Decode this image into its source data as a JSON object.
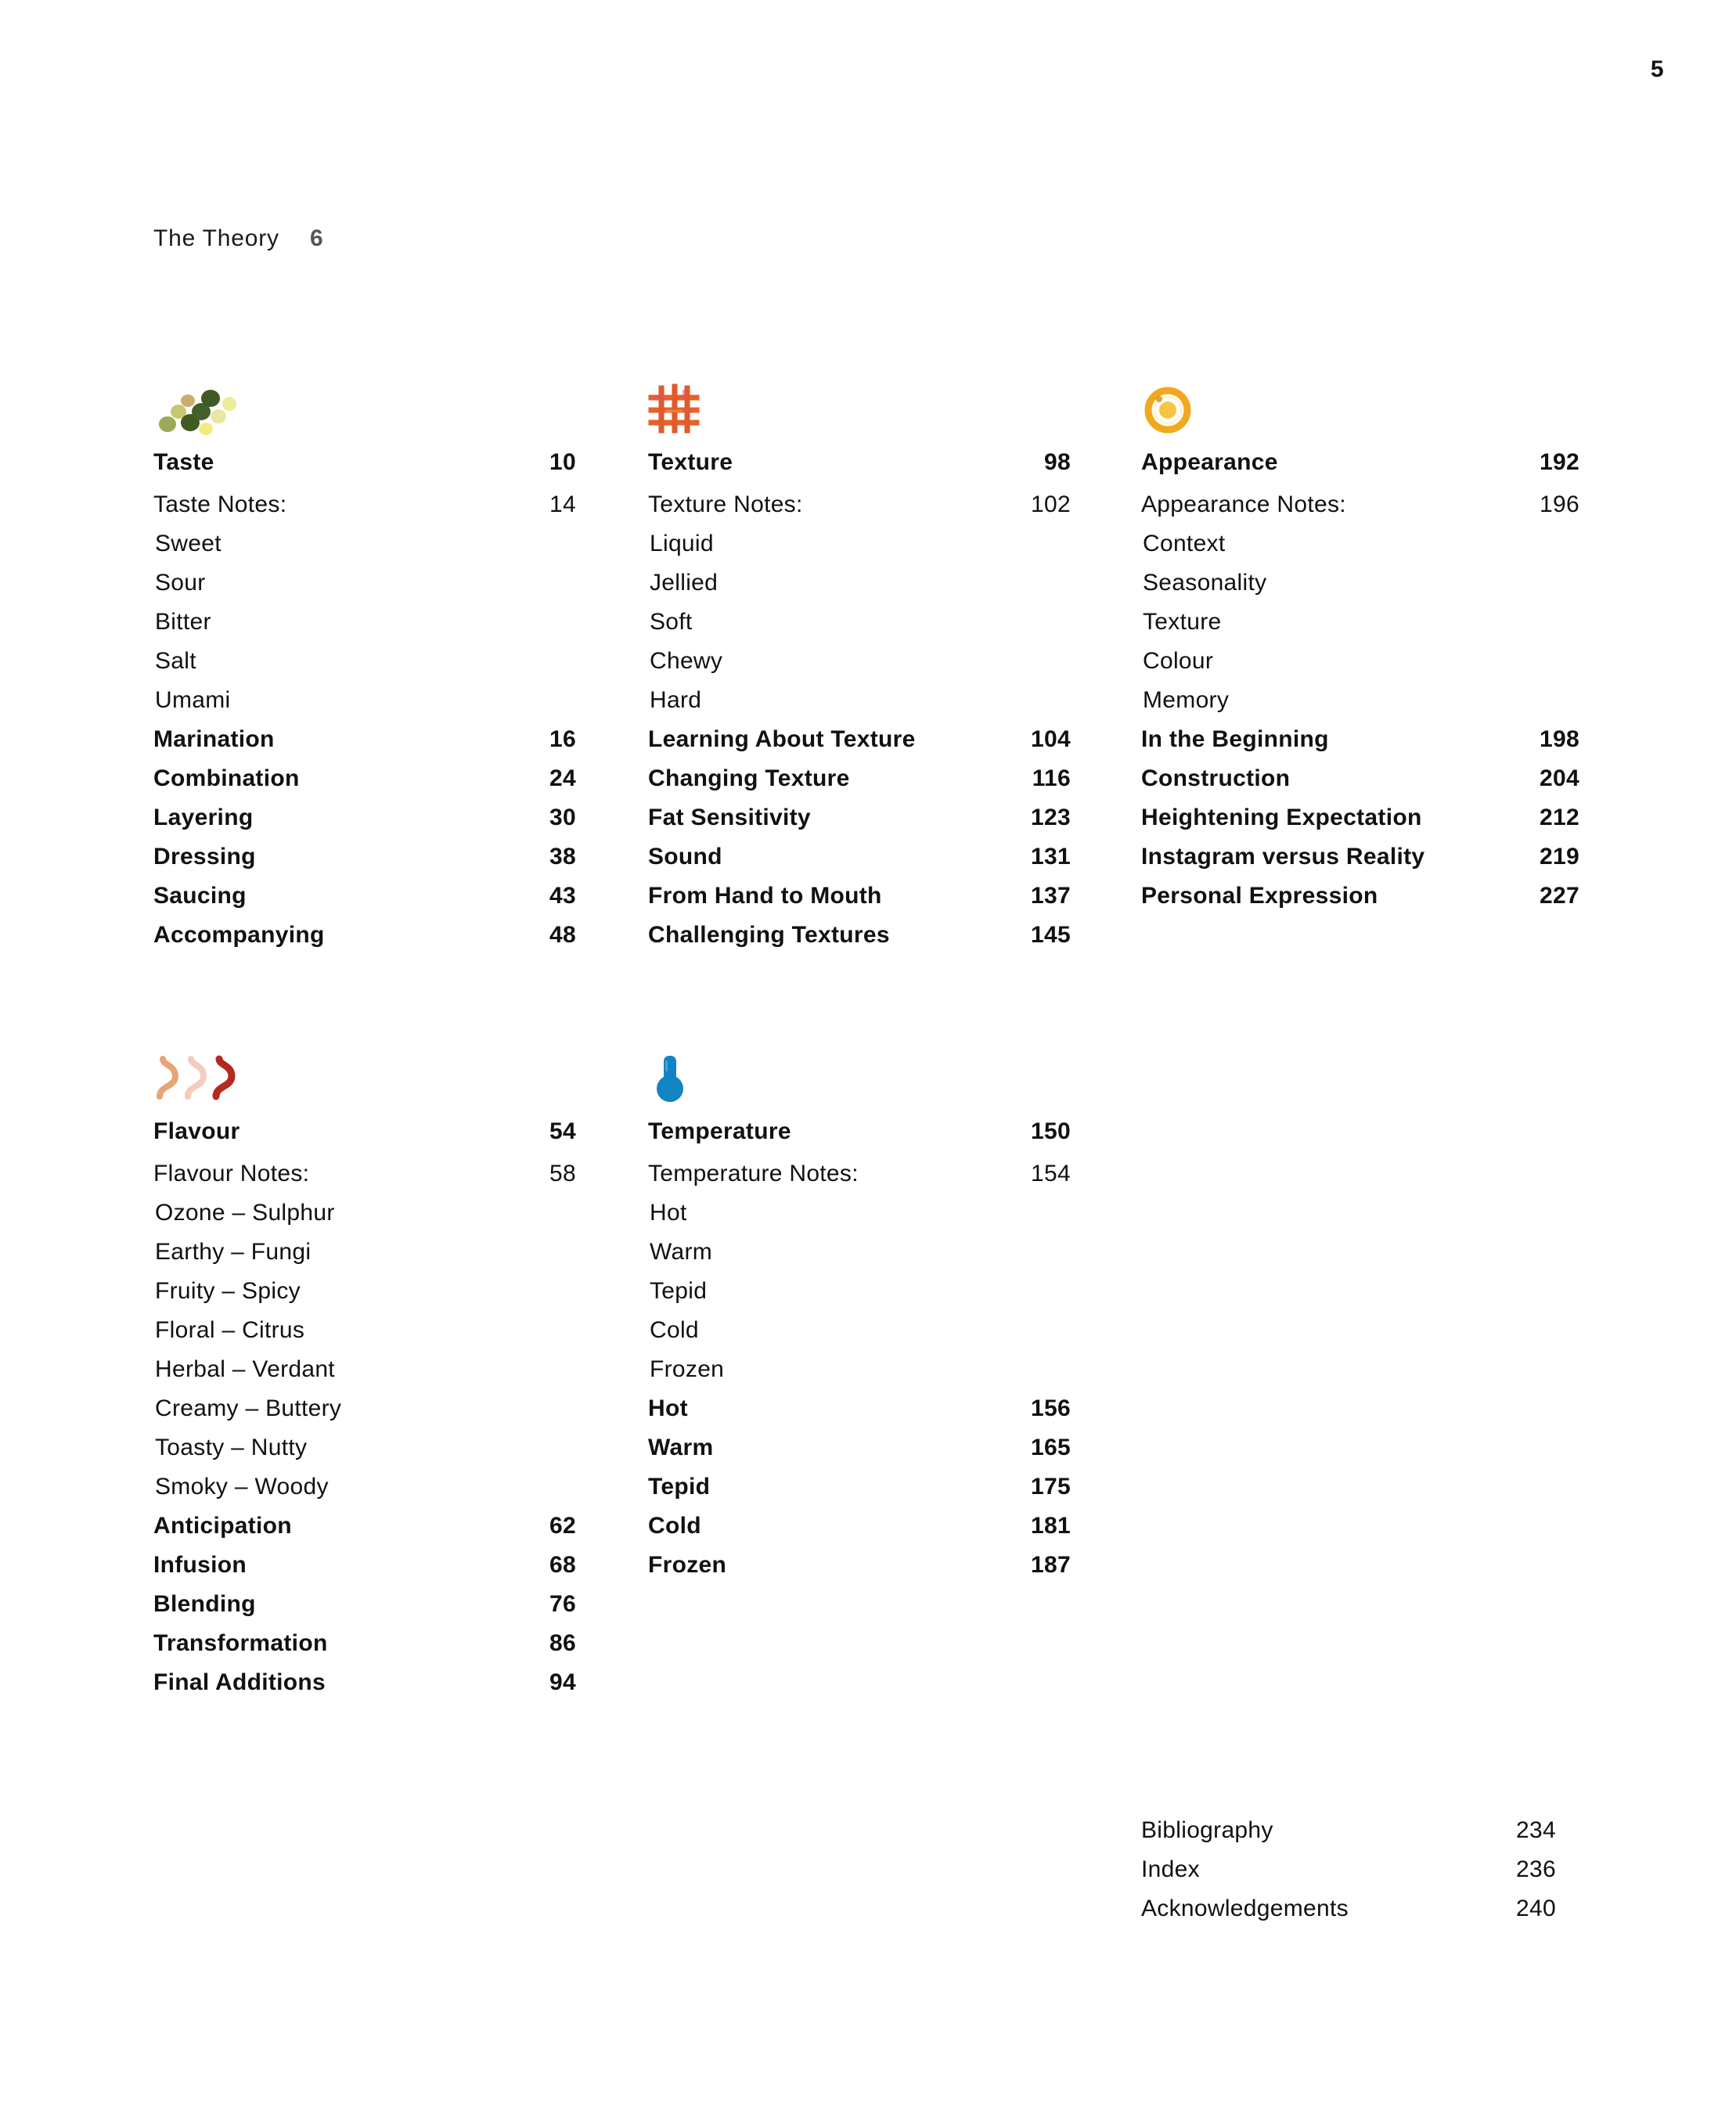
{
  "folio": "5",
  "running_head": {
    "label": "The Theory",
    "page": "6"
  },
  "colors": {
    "taste_dot_dark": "#4d6b2a",
    "taste_dot_light": "#e9e98a",
    "taste_dot_tan": "#c2a05a",
    "texture_grid": "#e8602c",
    "texture_grid_alt": "#d94f86",
    "appearance_ring": "#f0a81e",
    "appearance_ring_inner": "#f6c542",
    "flavour_squiggle_1": "#e8a478",
    "flavour_squiggle_2": "#f2cdbe",
    "flavour_squiggle_3": "#b5291e",
    "temperature_bulb": "#1184c4",
    "text": "#111111",
    "muted": "#555555"
  },
  "sections": [
    {
      "id": "taste",
      "icon": "scattered-dots-icon",
      "title": "Taste",
      "title_page": "10",
      "lead": {
        "label": "Taste Notes:",
        "page": "14"
      },
      "sub_items": [
        "Sweet",
        "Sour",
        "Bitter",
        "Salt",
        "Umami"
      ],
      "entries": [
        {
          "label": "Marination",
          "page": "16"
        },
        {
          "label": "Combination",
          "page": "24"
        },
        {
          "label": "Layering",
          "page": "30"
        },
        {
          "label": "Dressing",
          "page": "38"
        },
        {
          "label": "Saucing",
          "page": "43"
        },
        {
          "label": "Accompanying",
          "page": "48"
        }
      ]
    },
    {
      "id": "texture",
      "icon": "woven-grid-icon",
      "title": "Texture",
      "title_page": "98",
      "lead": {
        "label": "Texture Notes:",
        "page": "102"
      },
      "sub_items": [
        "Liquid",
        "Jellied",
        "Soft",
        "Chewy",
        "Hard"
      ],
      "entries": [
        {
          "label": "Learning About Texture",
          "page": "104"
        },
        {
          "label": "Changing Texture",
          "page": "116"
        },
        {
          "label": "Fat Sensitivity",
          "page": "123"
        },
        {
          "label": "Sound",
          "page": "131"
        },
        {
          "label": "From Hand to Mouth",
          "page": "137"
        },
        {
          "label": "Challenging Textures",
          "page": "145"
        }
      ]
    },
    {
      "id": "appearance",
      "icon": "concentric-ring-icon",
      "title": "Appearance",
      "title_page": "192",
      "lead": {
        "label": "Appearance Notes:",
        "page": "196"
      },
      "sub_items": [
        "Context",
        "Seasonality",
        "Texture",
        "Colour",
        "Memory"
      ],
      "entries": [
        {
          "label": "In the Beginning",
          "page": "198"
        },
        {
          "label": "Construction",
          "page": "204"
        },
        {
          "label": "Heightening Expectation",
          "page": "212"
        },
        {
          "label": "Instagram versus Reality",
          "page": "219"
        },
        {
          "label": "Personal Expression",
          "page": "227"
        }
      ]
    },
    {
      "id": "flavour",
      "icon": "aroma-squiggles-icon",
      "title": "Flavour",
      "title_page": "54",
      "lead": {
        "label": "Flavour Notes:",
        "page": "58"
      },
      "sub_items": [
        "Ozone – Sulphur",
        "Earthy – Fungi",
        "Fruity – Spicy",
        "Floral – Citrus",
        "Herbal – Verdant",
        "Creamy – Buttery",
        "Toasty – Nutty",
        "Smoky – Woody"
      ],
      "entries": [
        {
          "label": "Anticipation",
          "page": "62"
        },
        {
          "label": "Infusion",
          "page": "68"
        },
        {
          "label": "Blending",
          "page": "76"
        },
        {
          "label": "Transformation",
          "page": "86"
        },
        {
          "label": "Final Additions",
          "page": "94"
        }
      ]
    },
    {
      "id": "temperature",
      "icon": "thermometer-bulb-icon",
      "title": "Temperature",
      "title_page": "150",
      "lead": {
        "label": "Temperature Notes:",
        "page": "154"
      },
      "sub_items": [
        "Hot",
        "Warm",
        "Tepid",
        "Cold",
        "Frozen"
      ],
      "entries": [
        {
          "label": "Hot",
          "page": "156"
        },
        {
          "label": "Warm",
          "page": "165"
        },
        {
          "label": "Tepid",
          "page": "175"
        },
        {
          "label": "Cold",
          "page": "181"
        },
        {
          "label": "Frozen",
          "page": "187"
        }
      ]
    }
  ],
  "back_matter": [
    {
      "label": "Bibliography",
      "page": "234"
    },
    {
      "label": "Index",
      "page": "236"
    },
    {
      "label": "Acknowledgements",
      "page": "240"
    }
  ]
}
